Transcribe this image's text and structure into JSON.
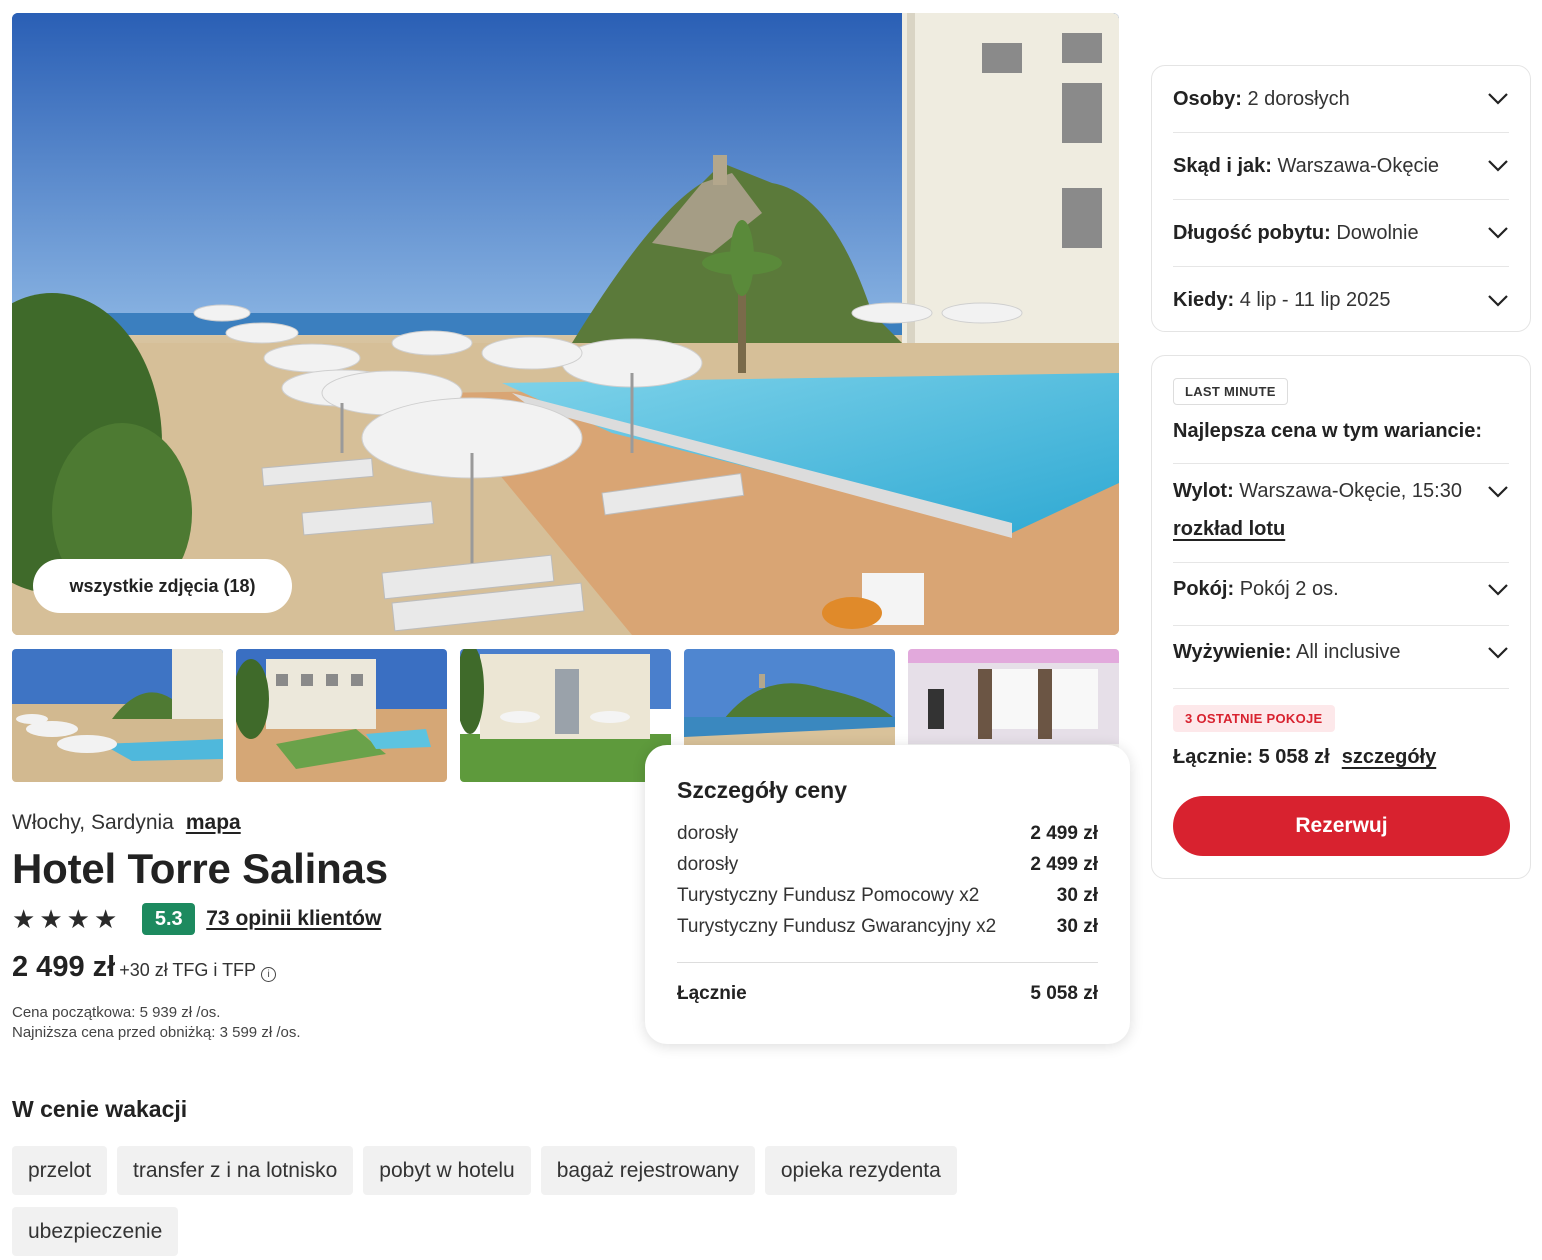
{
  "gallery": {
    "all_photos_label": "wszystkie zdjęcia (18)",
    "thumbnails": [
      {
        "icon": "pool-beach-thumbnail"
      },
      {
        "icon": "hotel-garden-pool-thumbnail"
      },
      {
        "icon": "hotel-lawn-thumbnail"
      },
      {
        "icon": "beach-tower-thumbnail"
      },
      {
        "icon": "hotel-room-thumbnail"
      }
    ]
  },
  "hotel": {
    "location": "Włochy, Sardynia",
    "map_link": "mapa",
    "name": "Hotel Torre Salinas",
    "stars": 4,
    "score": "5.3",
    "reviews_link": "73 opinii klientów",
    "price": "2 499 zł",
    "price_extra": "+30 zł TFG i TFP",
    "initial_price": "Cena początkowa: 5 939 zł /os.",
    "lowest_price": "Najniższa cena przed obniżką: 3 599 zł /os."
  },
  "included": {
    "title": "W cenie wakacji",
    "items": [
      "przelot",
      "transfer z i na lotnisko",
      "pobyt w hotelu",
      "bagaż rejestrowany",
      "opieka rezydenta",
      "ubezpieczenie"
    ]
  },
  "price_details": {
    "title": "Szczegóły ceny",
    "rows": [
      {
        "label": "dorosły",
        "value": "2 499 zł"
      },
      {
        "label": "dorosły",
        "value": "2 499 zł"
      },
      {
        "label": "Turystyczny Fundusz Pomocowy x2",
        "value": "30 zł"
      },
      {
        "label": "Turystyczny Fundusz Gwarancyjny x2",
        "value": "30 zł"
      }
    ],
    "total_label": "Łącznie",
    "total_value": "5 058 zł"
  },
  "filters": [
    {
      "label": "Osoby:",
      "value": "2 dorosłych"
    },
    {
      "label": "Skąd i jak:",
      "value": "Warszawa-Okęcie"
    },
    {
      "label": "Długość pobytu:",
      "value": "Dowolnie"
    },
    {
      "label": "Kiedy:",
      "value": "4 lip - 11 lip 2025"
    }
  ],
  "booking": {
    "badge": "LAST MINUTE",
    "best_price_label": "Najlepsza cena w tym wariancie:",
    "flight_label": "Wylot:",
    "flight_value": "Warszawa-Okęcie, 15:30",
    "flight_schedule_link": "rozkład lotu",
    "room_label": "Pokój:",
    "room_value": "Pokój 2 os.",
    "board_label": "Wyżywienie:",
    "board_value": "All inclusive",
    "urgent_badge": "3 OSTATNIE POKOJE",
    "total_label": "Łącznie: 5 058 zł",
    "details_link": "szczegóły",
    "reserve_label": "Rezerwuj"
  },
  "colors": {
    "accent_red": "#d8222f",
    "score_green": "#1d8a5f",
    "urgent_bg": "#fde8ea"
  }
}
